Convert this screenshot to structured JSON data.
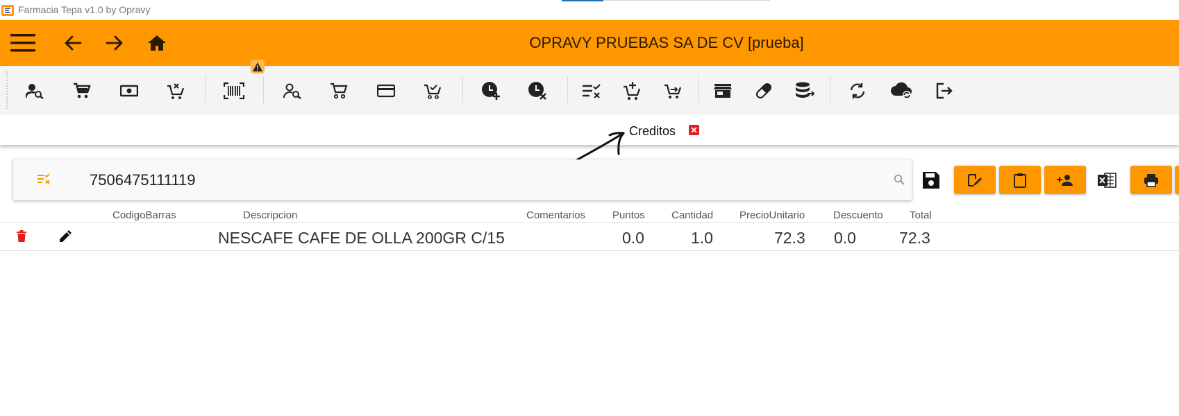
{
  "window": {
    "title": "Farmacia Tepa v1.0 by Opravy"
  },
  "header": {
    "company": "OPRAVY PRUEBAS SA DE CV [prueba]"
  },
  "nav": {
    "icons": [
      "menu-icon",
      "arrow-left-icon",
      "arrow-right-icon",
      "home-icon"
    ]
  },
  "toolbar": {
    "warning_icon": "warning-icon",
    "tools": [
      "person-search-icon",
      "cart-icon",
      "cash-icon",
      "cart-remove-icon",
      "barcode-scan-icon",
      "person-search-outline-icon",
      "cart-outline-icon",
      "credit-card-icon",
      "cart-check-outline-icon",
      "clock-plus-icon",
      "clock-remove-icon",
      "list-check-icon",
      "cart-plus-icon",
      "cart-arrow-icon",
      "store-icon",
      "pill-icon",
      "database-export-icon",
      "sync-icon",
      "cloud-sync-icon",
      "logout-icon"
    ]
  },
  "tabs": [
    {
      "label": "Creditos",
      "active": true
    }
  ],
  "search": {
    "value": "7506475111119",
    "placeholder": ""
  },
  "actions": [
    "save-icon",
    "sign-edit-icon",
    "clipboard-icon",
    "add-person-icon",
    "excel-icon",
    "print-icon"
  ],
  "table": {
    "columns": [
      "CodigoBarras",
      "Descripcion",
      "Comentarios",
      "Puntos",
      "Cantidad",
      "PrecioUnitario",
      "Descuento",
      "Total"
    ],
    "rows": [
      {
        "codigo": "",
        "descripcion": "NESCAFE CAFE DE OLLA 200GR C/15",
        "comentarios": "",
        "puntos": "0.0",
        "cantidad": "1.0",
        "precio": "72.3",
        "descuento": "0.0",
        "total": "72.3"
      }
    ]
  },
  "colors": {
    "accent": "#ff9800",
    "danger": "#e41e1e",
    "toolbar_bg": "#f4f4f4"
  }
}
